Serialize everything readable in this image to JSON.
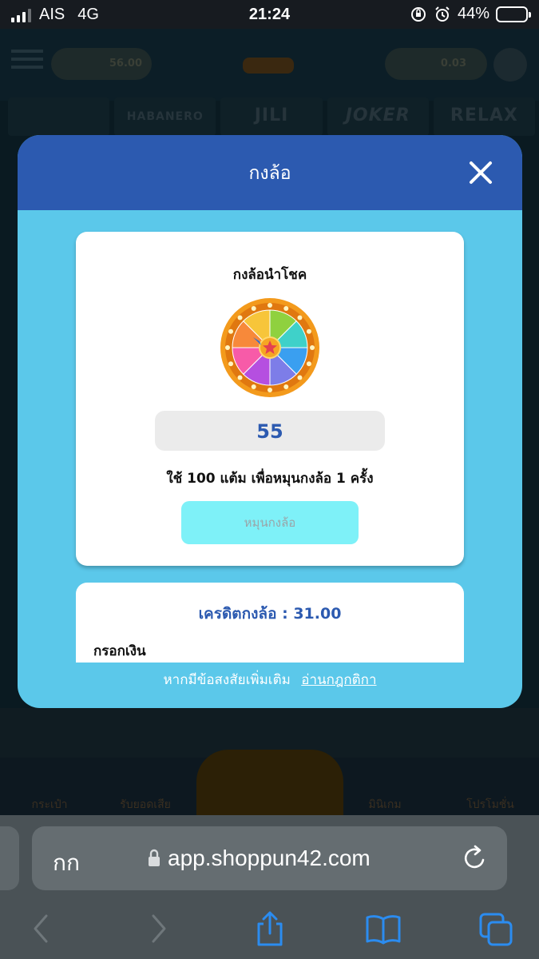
{
  "status_bar": {
    "carrier": "AIS",
    "network": "4G",
    "time": "21:24",
    "battery": "44%",
    "battery_level": 0.44
  },
  "background_site": {
    "balance": "56.00",
    "points": "0.03",
    "providers": [
      "",
      "HABANERO",
      "JILI",
      "JOKER",
      "RELAX"
    ],
    "nav": [
      "กระเป๋า",
      "รับยอดเสีย",
      "",
      "มินิเกม",
      "โปรโมชั่น"
    ]
  },
  "modal": {
    "title": "กงล้อ",
    "wheel_card": {
      "title": "กงล้อนำโชค",
      "points_value": "55",
      "cost_note": "ใช้ 100 แต้ม เพื่อหมุนกงล้อ 1 ครั้ง",
      "spin_label": "หมุนกงล้อ"
    },
    "credit_card": {
      "credit_label": "เครดิตกงล้อ :",
      "credit_value": "31.00",
      "deposit_label": "กรอกเงิน"
    },
    "footer": {
      "question": "หากมีข้อสงสัยเพิ่มเติม",
      "rules_link": "อ่านกฎกติกา"
    }
  },
  "safari": {
    "aa_label": "กก",
    "url": "app.shoppun42.com"
  },
  "colors": {
    "modal_bg": "#5bc8ea",
    "header_blue": "#2c5ab0",
    "spin_button": "#7ef1f8",
    "accent_text": "#2c5ab0"
  }
}
